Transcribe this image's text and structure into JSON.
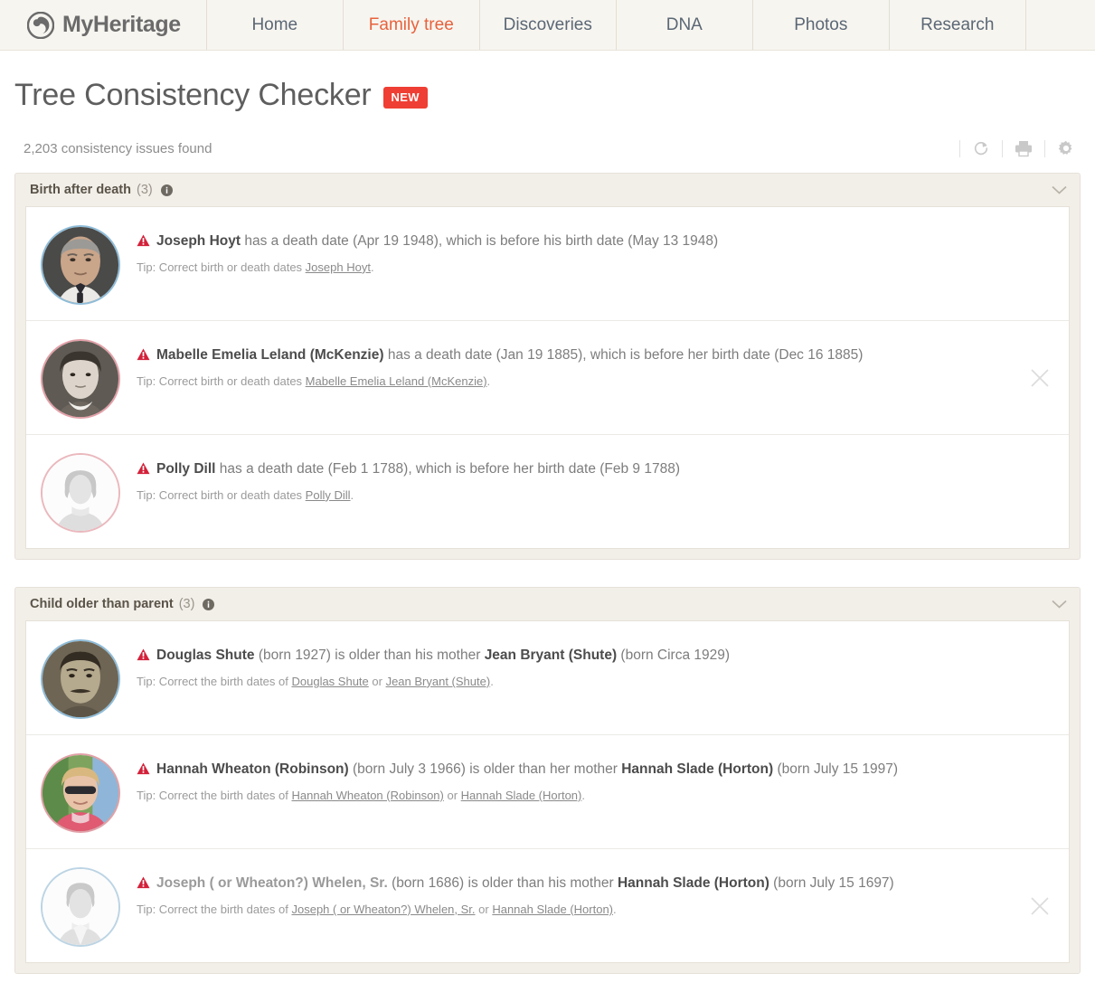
{
  "nav": {
    "brand": "MyHeritage",
    "items": [
      {
        "label": "Home",
        "active": false
      },
      {
        "label": "Family tree",
        "active": true
      },
      {
        "label": "Discoveries",
        "active": false
      },
      {
        "label": "DNA",
        "active": false
      },
      {
        "label": "Photos",
        "active": false
      },
      {
        "label": "Research",
        "active": false
      }
    ]
  },
  "header": {
    "title": "Tree Consistency Checker",
    "badge": "NEW",
    "issues_found": "2,203 consistency issues found",
    "tools": [
      {
        "name": "refresh-icon",
        "label": "Refresh"
      },
      {
        "name": "print-icon",
        "label": "Print"
      },
      {
        "name": "gear-icon",
        "label": "Settings"
      }
    ]
  },
  "sections": [
    {
      "title": "Birth after death",
      "count": "(3)",
      "issues": [
        {
          "avatar": "photo-man-elderly",
          "avatar_gender": "male",
          "pre": "",
          "person": "Joseph Hoyt",
          "post": " has a death date (Apr 19 1948), which is before his birth date (May 13 1948)",
          "tip_prefix": "Tip: Correct birth or death dates ",
          "tip_link1": "Joseph Hoyt",
          "tip_mid": "",
          "tip_link2": "",
          "tip_suffix": ".",
          "dismissable": false
        },
        {
          "avatar": "photo-woman-vintage",
          "avatar_gender": "female",
          "pre": "",
          "person": "Mabelle Emelia Leland (McKenzie)",
          "post": " has a death date (Jan 19 1885), which is before her birth date (Dec 16 1885)",
          "tip_prefix": "Tip: Correct birth or death dates ",
          "tip_link1": "Mabelle Emelia Leland (McKenzie)",
          "tip_mid": "",
          "tip_link2": "",
          "tip_suffix": ".",
          "dismissable": true
        },
        {
          "avatar": "placeholder-female",
          "avatar_gender": "female",
          "pre": "",
          "person": "Polly Dill",
          "post": " has a death date (Feb 1 1788), which is before her birth date (Feb 9 1788)",
          "tip_prefix": "Tip: Correct birth or death dates ",
          "tip_link1": "Polly Dill",
          "tip_mid": "",
          "tip_link2": "",
          "tip_suffix": ".",
          "dismissable": false
        }
      ]
    },
    {
      "title": "Child older than parent",
      "count": "(3)",
      "issues": [
        {
          "avatar": "photo-man-sepia",
          "avatar_gender": "male",
          "pre": "",
          "person": "Douglas Shute",
          "post": " (born 1927) is older than his mother ",
          "person2": "Jean Bryant (Shute)",
          "post2": " (born Circa 1929)",
          "tip_prefix": "Tip: Correct the birth dates of ",
          "tip_link1": "Douglas Shute",
          "tip_mid": " or ",
          "tip_link2": "Jean Bryant (Shute)",
          "tip_suffix": ".",
          "dismissable": false
        },
        {
          "avatar": "photo-woman-sunglasses",
          "avatar_gender": "female",
          "pre": "",
          "person": "Hannah Wheaton (Robinson)",
          "post": " (born July 3 1966) is older than her mother ",
          "person2": "Hannah Slade (Horton)",
          "post2": " (born July 15 1997)",
          "tip_prefix": "Tip: Correct the birth dates of ",
          "tip_link1": "Hannah Wheaton (Robinson)",
          "tip_mid": " or ",
          "tip_link2": "Hannah Slade (Horton)",
          "tip_suffix": ".",
          "dismissable": false
        },
        {
          "avatar": "placeholder-male",
          "avatar_gender": "male",
          "pre": "",
          "person": "Joseph ( or Wheaton?) Whelen, Sr.",
          "person_dim": true,
          "post": " (born 1686) is older than his mother ",
          "person2": "Hannah Slade (Horton)",
          "post2": " (born July 15 1697)",
          "tip_prefix": "Tip: Correct the birth dates of ",
          "tip_link1": "Joseph ( or Wheaton?) Whelen, Sr.",
          "tip_mid": " or ",
          "tip_link2": "Hannah Slade (Horton)",
          "tip_suffix": ".",
          "dismissable": true
        }
      ]
    }
  ],
  "colors": {
    "accent": "#e8623c",
    "badge": "#ef3e33",
    "warning": "#d3213a",
    "nav_bg": "#f7f5f0",
    "section_bg": "#f2efe9"
  }
}
